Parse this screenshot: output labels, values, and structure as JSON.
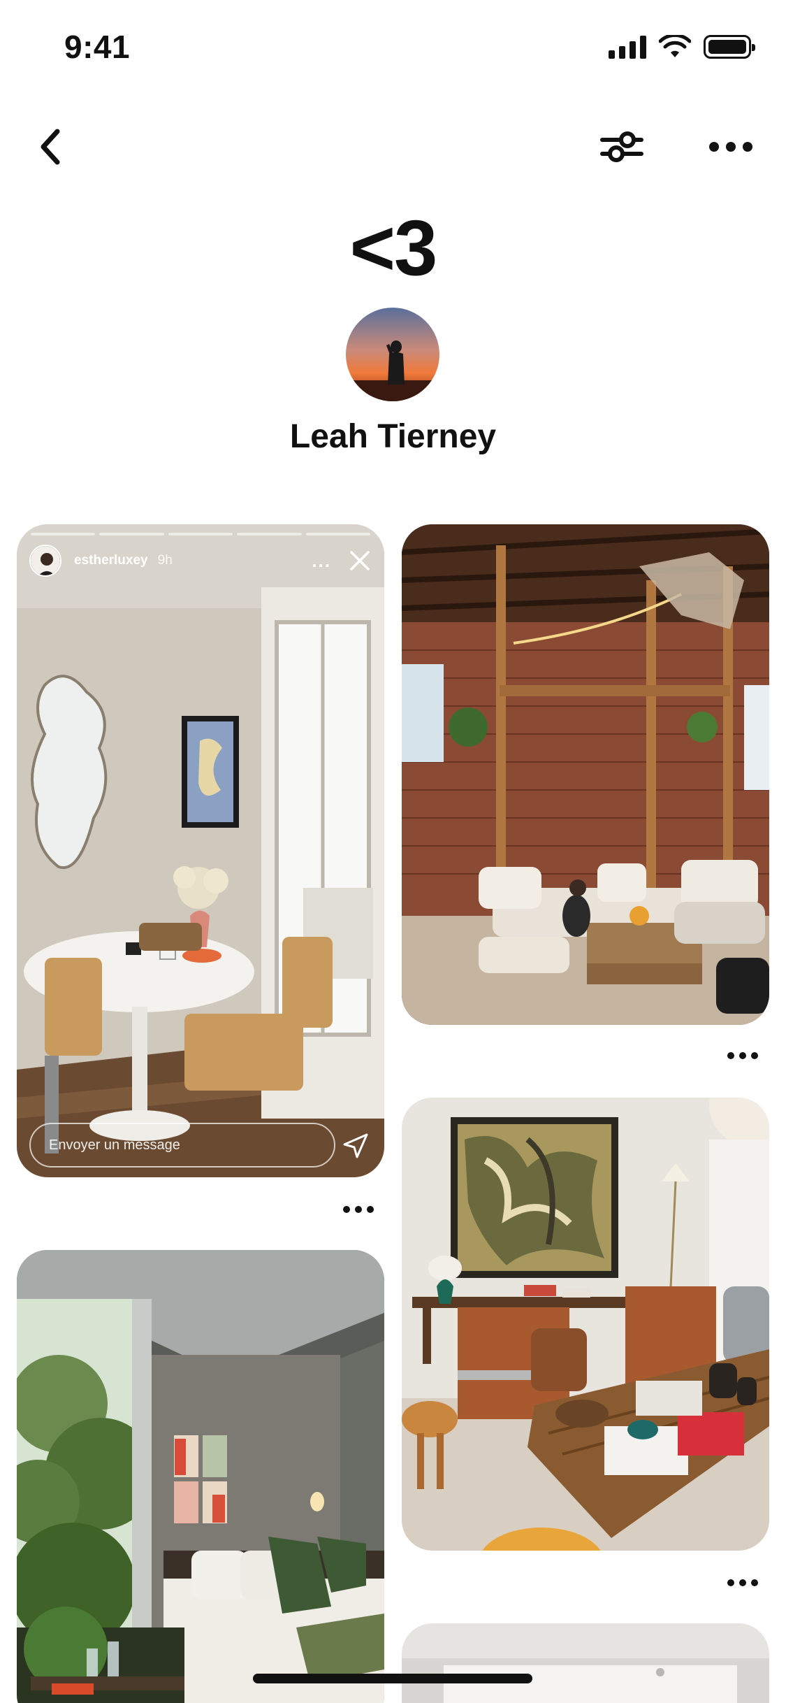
{
  "status_bar": {
    "time": "9:41"
  },
  "board": {
    "title": "<3",
    "owner_name": "Leah Tierney"
  },
  "pins": [
    {
      "story": {
        "username": "estherluxey",
        "time": "9h",
        "menu": "...",
        "message_placeholder": "Envoyer un message"
      }
    }
  ],
  "icons": {
    "back": "chevron-left-icon",
    "filter": "sliders-icon",
    "more": "ellipsis-icon"
  }
}
